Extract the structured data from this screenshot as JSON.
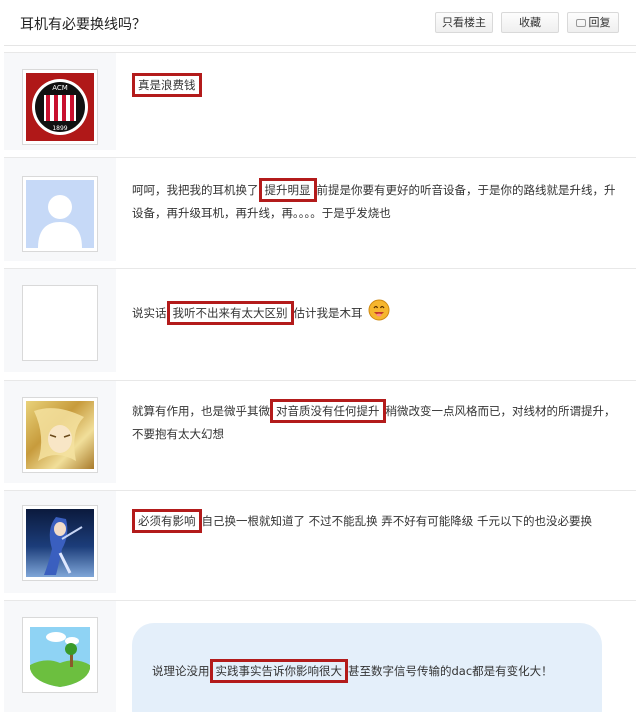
{
  "header": {
    "title": "耳机有必要换线吗？",
    "only_author": "只看楼主",
    "favorite": "收藏",
    "reply": "回复"
  },
  "posts": [
    {
      "avatar": "ac-milan-logo",
      "avatar_text": "ACM",
      "avatar_year": "1899",
      "pre": "",
      "highlight": "真是浪费钱",
      "post": ""
    },
    {
      "avatar": "default-user-silhouette",
      "pre": "呵呵，我把我的耳机换了",
      "highlight": "提升明显",
      "post": "前提是你要有更好的听音设备，于是你的路线就是升线，升设备，再升级耳机，再升线，再。。。。于是乎发烧也"
    },
    {
      "avatar": "blank",
      "pre": "说实话",
      "highlight": "我听不出来有太大区别",
      "post": "估计我是木耳",
      "emoji": "smile-emoticon"
    },
    {
      "avatar": "anime-blonde-character",
      "pre": "就算有作用，也是微乎其微",
      "highlight": "对音质没有任何提升",
      "post": "稍微改变一点风格而已，对线材的所谓提升，不要抱有太大幻想"
    },
    {
      "avatar": "anime-blue-hair-character",
      "pre": "",
      "highlight": "必须有影响",
      "post": "自己换一根就知道了 不过不能乱换 弄不好有可能降级 千元以下的也没必要换"
    },
    {
      "avatar": "cartoon-landscape",
      "pre": "说理论没用",
      "highlight": "实践事实告诉你影响很大",
      "post": "甚至数字信号传输的dac都是有变化大！"
    }
  ],
  "colors": {
    "highlight_border": "#b31b1b",
    "bubble": "#e4effa",
    "side": "#f7f8fa"
  }
}
